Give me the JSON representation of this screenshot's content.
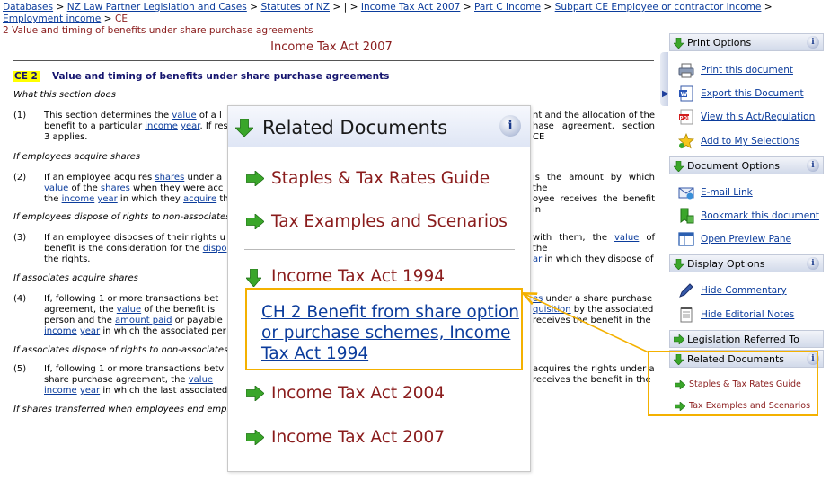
{
  "breadcrumb": {
    "items": [
      "Databases",
      "NZ Law Partner Legislation and Cases",
      "Statutes of NZ",
      "|",
      "Income Tax Act 2007",
      "Part C Income",
      "Subpart CE Employee or contractor income",
      "Employment income"
    ],
    "current_line1": "CE",
    "current_line2": "2 Value and timing of benefits under share purchase agreements"
  },
  "document": {
    "title": "Income Tax Act 2007",
    "section_number": "CE 2",
    "section_heading": "Value and timing of benefits under share purchase agreements",
    "subheadings": {
      "s1": "What this section does",
      "s2": "If employees acquire shares",
      "s3": "If employees dispose of rights to non-associates",
      "s4": "If associates acquire shares",
      "s5": "If associates dispose of rights to non-associates",
      "s6": "If shares transferred when employees end employr"
    },
    "paras": {
      "p1": {
        "num": "(1)",
        "l1": [
          "This section determines the ",
          "value",
          " of a l"
        ],
        "l2": [
          "benefit to a particular ",
          "income",
          " ",
          "year",
          ". If res"
        ],
        "l3": [
          "3 applies."
        ],
        "r1": [
          "nt and the allocation of the"
        ],
        "r2": [
          "hase agreement, section CE"
        ]
      },
      "p2": {
        "num": "(2)",
        "l1": [
          "If an employee acquires ",
          "shares",
          " under a"
        ],
        "l2": [
          "value",
          " of the ",
          "shares",
          " when they were acc"
        ],
        "l3": [
          "the ",
          "income",
          " ",
          "year",
          " in which they ",
          "acquire",
          " th"
        ],
        "r1": [
          "is the amount by which the"
        ],
        "r2": [
          "oyee receives the benefit in"
        ]
      },
      "p3": {
        "num": "(3)",
        "l1": [
          "If an employee disposes of their rights u"
        ],
        "l2": [
          "benefit is the consideration for the ",
          "dispo"
        ],
        "l3": [
          "the rights."
        ],
        "r1": [
          "with them, the ",
          "value",
          " of the"
        ],
        "r2": [
          "ar",
          " in which they dispose of"
        ]
      },
      "p4": {
        "num": "(4)",
        "l1": [
          "If, following 1 or more transactions bet"
        ],
        "l2": [
          "agreement, the ",
          "value",
          " of the benefit is"
        ],
        "l3": [
          "person and the ",
          "amount paid",
          " or payable"
        ],
        "l4": [
          "income",
          " ",
          "year",
          " in which the associated per"
        ],
        "r1": [
          "es",
          " under a share purchase"
        ],
        "r2": [
          "quisition",
          " by the associated"
        ],
        "r3": [
          "receives the benefit in the"
        ]
      },
      "p5": {
        "num": "(5)",
        "l1": [
          "If, following 1 or more transactions betv"
        ],
        "l2": [
          "share purchase agreement, the ",
          "value"
        ],
        "l3": [
          "income",
          " ",
          "year",
          " in which the last associated"
        ],
        "r1": [
          "acquires the rights under a"
        ],
        "r2": [
          "receives the benefit in the"
        ]
      }
    }
  },
  "popup": {
    "title": "Related Documents",
    "items": [
      "Staples & Tax Rates Guide",
      "Tax Examples and Scenarios",
      "Income Tax Act 1994"
    ],
    "highlighted_link": "CH 2 Benefit from share option or purchase schemes, Income Tax Act 1994",
    "items_after": [
      "Income Tax Act 2004",
      "Income Tax Act 2007"
    ]
  },
  "sidebar": {
    "print_options": {
      "header": "Print Options",
      "items": [
        {
          "label": "Print this document",
          "icon": "printer-icon"
        },
        {
          "label": "Export this Document",
          "icon": "word-doc-icon"
        },
        {
          "label": "View this Act/Regulation",
          "icon": "pdf-icon"
        },
        {
          "label": "Add to My Selections",
          "icon": "star-icon"
        }
      ]
    },
    "document_options": {
      "header": "Document Options",
      "items": [
        {
          "label": "E-mail Link",
          "icon": "email-icon"
        },
        {
          "label": "Bookmark this document",
          "icon": "bookmark-icon"
        },
        {
          "label": "Open Preview Pane",
          "icon": "preview-pane-icon"
        }
      ]
    },
    "display_options": {
      "header": "Display Options",
      "items": [
        {
          "label": "Hide Commentary",
          "icon": "pen-icon"
        },
        {
          "label": "Hide Editorial Notes",
          "icon": "notepad-icon"
        }
      ]
    },
    "legislation_referred": {
      "header": "Legislation Referred To"
    },
    "related_documents": {
      "header": "Related Documents",
      "items": [
        "Staples & Tax Rates Guide",
        "Tax Examples and Scenarios"
      ]
    }
  },
  "colors": {
    "link": "#0b3c9c",
    "title": "#8a1c1c",
    "highlight_box": "#f4b100",
    "arrow_green": "#3aa62a"
  }
}
